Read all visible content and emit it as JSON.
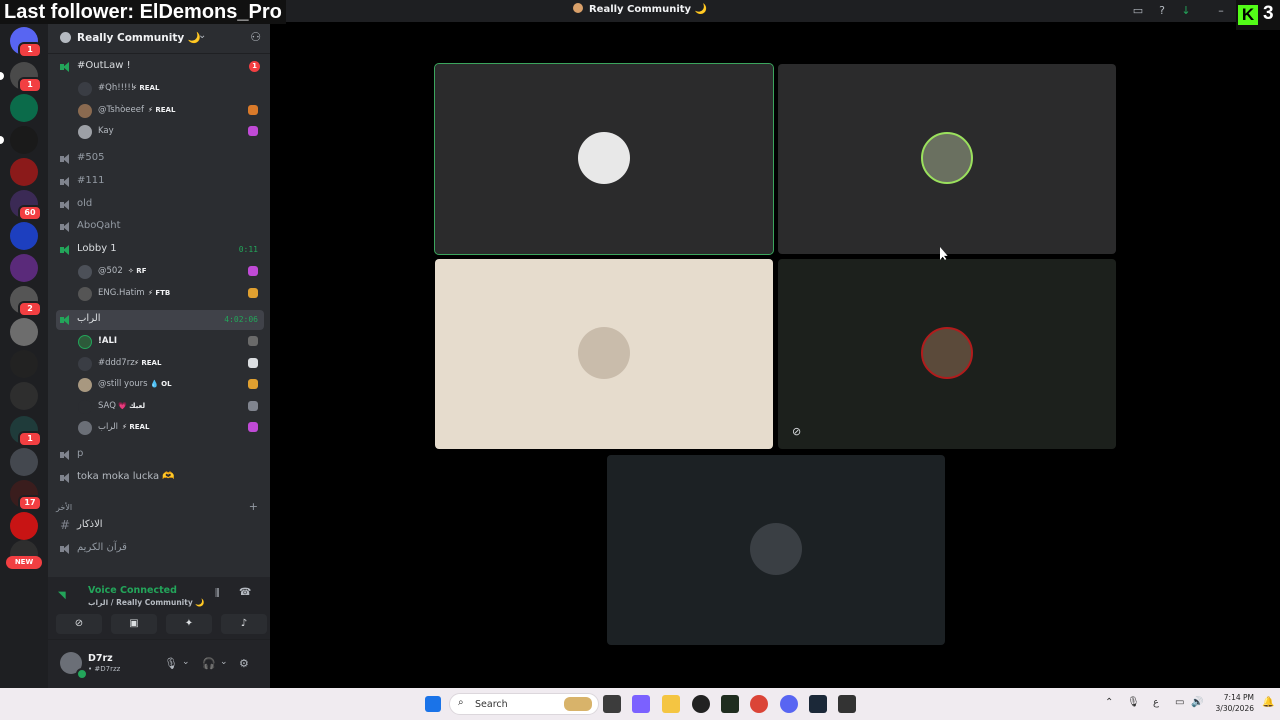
{
  "overlay": {
    "follower_text": "Last follower: ElDemons_Pro",
    "kick_logo": "K",
    "kick_count": "3"
  },
  "window": {
    "title": "Really Community 🌙"
  },
  "server_rail": {
    "badges": [
      "1",
      "1",
      "60",
      "2",
      "1",
      "17"
    ],
    "new_label": "NEW"
  },
  "guild": {
    "name": "Really Community 🌙"
  },
  "channels": [
    {
      "name": "#OutLaw !",
      "mention": "1"
    },
    {
      "name": "#505"
    },
    {
      "name": "#111"
    },
    {
      "name": "old"
    },
    {
      "name": "AboQaht"
    },
    {
      "name": "Lobby 1",
      "timer": "0:11"
    },
    {
      "name": "الراب",
      "timer": "4:02:06"
    },
    {
      "name": "p"
    },
    {
      "name": "toka moka lucka 🫶"
    }
  ],
  "users_outlaw": [
    {
      "name": "#Qh!!!!!",
      "tag": "⚡ REAL"
    },
    {
      "name": "@Tshòeeef",
      "tag": "⚡ REAL"
    },
    {
      "name": "Kay",
      "tag": ""
    }
  ],
  "users_lobby": [
    {
      "name": "@502",
      "tag": "✧ RF"
    },
    {
      "name": "ENG.Hatim",
      "tag": "⚡ FTB"
    }
  ],
  "users_rap": [
    {
      "name": "!ALI",
      "tag": ""
    },
    {
      "name": "#ddd7rz",
      "tag": "⚡ REAL"
    },
    {
      "name": "@still yours",
      "tag": "💧 OL"
    },
    {
      "name": "SAQ",
      "tag": "💗 لعبك"
    },
    {
      "name": "الراب",
      "tag": "⚡ REAL"
    }
  ],
  "category": {
    "name": "الأخر"
  },
  "text_channels": [
    {
      "name": "الاذكار"
    },
    {
      "name": "قرآن الكريم"
    }
  ],
  "voice": {
    "status": "Voice Connected",
    "channel": "الراب / Really Community 🌙"
  },
  "user": {
    "name": "D7rz",
    "tag": "• #D7rzz"
  },
  "taskbar": {
    "search_placeholder": "Search",
    "time": "7:14 PM",
    "date": "3/30/2026"
  },
  "colors": {
    "accent_green": "#23a55a",
    "mention_red": "#f23f42",
    "kick_green": "#53fc18"
  }
}
